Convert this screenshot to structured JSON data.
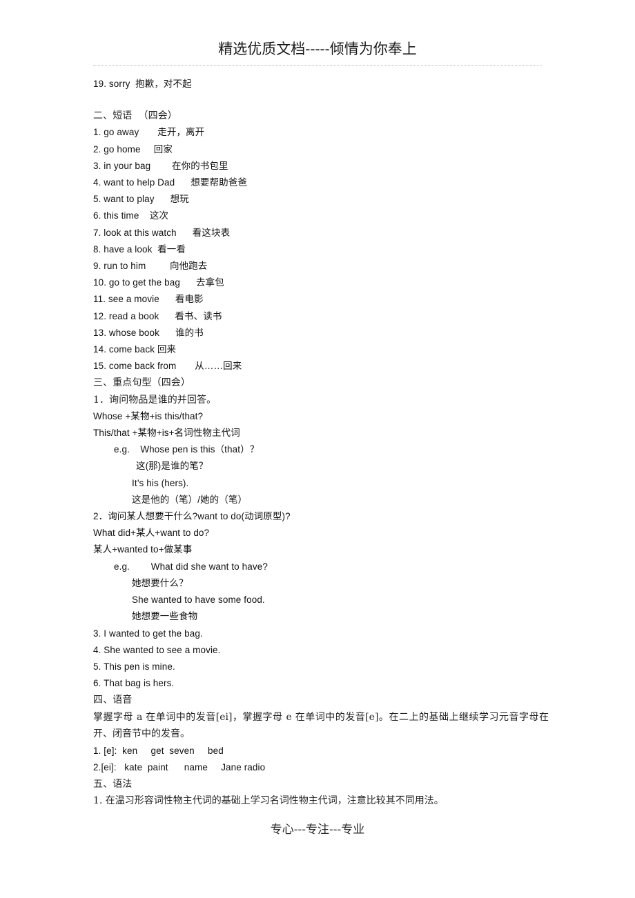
{
  "header": {
    "title": "精选优质文档-----倾情为你奉上",
    "rule": "dotted-divider"
  },
  "footer": {
    "text": "专心---专注---专业"
  },
  "body": {
    "trailing_vocab_item": "19. sorry  抱歉，对不起",
    "section_two": {
      "heading": "二、短语  （四会）",
      "items": [
        "1. go away       走开，离开",
        "2. go home     回家",
        "3. in your bag        在你的书包里",
        "4. want to help Dad      想要帮助爸爸",
        "5. want to play      想玩",
        "6. this time    这次",
        "7. look at this watch      看这块表",
        "8. have a look  看一看",
        "9. run to him         向他跑去",
        "10. go to get the bag      去拿包",
        "11. see a movie      看电影",
        "12. read a book      看书、读书",
        "13. whose book      谁的书",
        "14. come back 回来",
        "15. come back from       从……回来"
      ]
    },
    "section_three": {
      "heading": "三、重点句型（四会）",
      "pattern_one": {
        "number": "1．询问物品是谁的并回答。",
        "form_a": "Whose +某物+is this/that?",
        "form_b": "This/that +某物+is+名词性物主代词",
        "example_label_line": "e.g.    Whose pen is this（that）？",
        "example_cn_1": "这(那)是谁的笔？",
        "example_en_2": "It’s his (hers).",
        "example_cn_2": "这是他的（笔）/她的（笔）"
      },
      "pattern_two": {
        "number": "2．询问某人想要干什么?want to do(动词原型)?",
        "form_a": "What did+某人+want to do?",
        "form_b": "某人+wanted to+做某事",
        "example_label_line": "e.g.        What did she want to have?",
        "example_cn_1": "她想要什么？",
        "example_en_2": "She wanted to have some food.",
        "example_cn_2": "她想要一些食物"
      },
      "sentences": [
        "3. I wanted to get the bag.",
        "4. She wanted to see a movie.",
        "5. This pen is mine.",
        "6. That bag is hers."
      ]
    },
    "section_four": {
      "heading": "四、语音",
      "paragraph": "掌握字母 a 在单词中的发音[ei]，掌握字母 e 在单词中的发音[e]。在二上的基础上继续学习元音字母在开、闭音节中的发音。",
      "items": [
        "1. [e]:  ken     get  seven     bed",
        "2.[ei]:   kate  paint      name     Jane radio"
      ]
    },
    "section_five": {
      "heading": "五、语法",
      "items": [
        "1. 在温习形容词性物主代词的基础上学习名词性物主代词，注意比较其不同用法。"
      ]
    }
  }
}
